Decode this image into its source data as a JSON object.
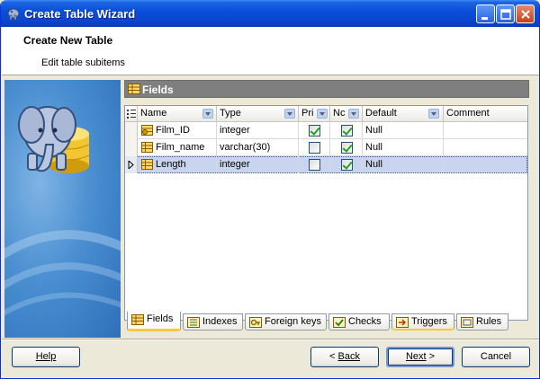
{
  "window": {
    "title": "Create Table Wizard"
  },
  "header": {
    "title": "Create New Table",
    "subtitle": "Edit table subitems"
  },
  "panel": {
    "title": "Fields"
  },
  "grid": {
    "columns": [
      "Name",
      "Type",
      "Pri",
      "Nc",
      "Default",
      "Comment"
    ],
    "rows": [
      {
        "name": "Film_ID",
        "type": "integer",
        "primary": true,
        "not_null": true,
        "default": "Null",
        "comment": ""
      },
      {
        "name": "Film_name",
        "type": "varchar(30)",
        "primary": false,
        "not_null": true,
        "default": "Null",
        "comment": ""
      },
      {
        "name": "Length",
        "type": "integer",
        "primary": false,
        "not_null": true,
        "default": "Null",
        "comment": ""
      }
    ],
    "selected_row": 2
  },
  "tabs": [
    {
      "label": "Fields",
      "icon": "fields-icon",
      "active": true
    },
    {
      "label": "Indexes",
      "icon": "indexes-icon"
    },
    {
      "label": "Foreign keys",
      "icon": "foreign-keys-icon"
    },
    {
      "label": "Checks",
      "icon": "checks-icon"
    },
    {
      "label": "Triggers",
      "icon": "triggers-icon"
    },
    {
      "label": "Rules",
      "icon": "rules-icon"
    }
  ],
  "buttons": {
    "help": "Help",
    "back_arrow": "< ",
    "back": "Back",
    "next": "Next",
    "next_arrow": " >",
    "cancel": "Cancel"
  },
  "colors": {
    "title_bar": "#0A4FD8",
    "selection": "#C9D5EE",
    "panel_header": "#7F7F7F",
    "tab_accent": "#FFC83C"
  }
}
